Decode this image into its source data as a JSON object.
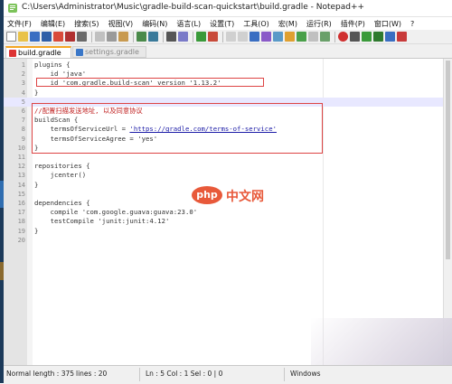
{
  "window": {
    "title": "C:\\Users\\Administrator\\Music\\gradle-build-scan-quickstart\\build.gradle - Notepad++"
  },
  "menu": [
    "文件(F)",
    "编辑(E)",
    "搜索(S)",
    "视图(V)",
    "编码(N)",
    "语言(L)",
    "设置(T)",
    "工具(O)",
    "宏(M)",
    "运行(R)",
    "插件(P)",
    "窗口(W)",
    "?"
  ],
  "tabs": [
    {
      "label": "build.gradle",
      "active": true
    },
    {
      "label": "settings.gradle",
      "active": false
    }
  ],
  "editor": {
    "current_line": 5,
    "lines": [
      {
        "n": "1",
        "text": "plugins {"
      },
      {
        "n": "2",
        "text": "    id 'java'"
      },
      {
        "n": "3",
        "text": "    id 'com.gradle.build-scan' version '1.13.2'"
      },
      {
        "n": "4",
        "text": "}"
      },
      {
        "n": "5",
        "text": ""
      },
      {
        "n": "6",
        "text": "//配置扫描发送地址, 以及同意协议"
      },
      {
        "n": "7",
        "text": "buildScan {"
      },
      {
        "n": "8",
        "pre": "    termsOfServiceUrl = ",
        "url": "'https://gradle.com/terms-of-service'"
      },
      {
        "n": "9",
        "text": "    termsOfServiceAgree = 'yes'"
      },
      {
        "n": "10",
        "text": "}"
      },
      {
        "n": "11",
        "text": ""
      },
      {
        "n": "12",
        "text": "repositories {"
      },
      {
        "n": "13",
        "text": "    jcenter()"
      },
      {
        "n": "14",
        "text": "}"
      },
      {
        "n": "15",
        "text": ""
      },
      {
        "n": "16",
        "text": "dependencies {"
      },
      {
        "n": "17",
        "text": "    compile 'com.google.guava:guava:23.0'"
      },
      {
        "n": "18",
        "text": "    testCompile 'junit:junit:4.12'"
      },
      {
        "n": "19",
        "text": "}"
      },
      {
        "n": "20",
        "text": ""
      }
    ]
  },
  "watermark": {
    "logo": "php",
    "text": "中文网"
  },
  "status": {
    "length": "Normal length : 375",
    "lines": "lines : 20",
    "position": "Ln : 5    Col : 1    Sel : 0 | 0",
    "eol": "Windows"
  },
  "colors": {
    "accent_tab": "#f5a623",
    "highlight_box": "#dd4444",
    "current_line": "#e8e8ff",
    "watermark": "#e8593a"
  }
}
